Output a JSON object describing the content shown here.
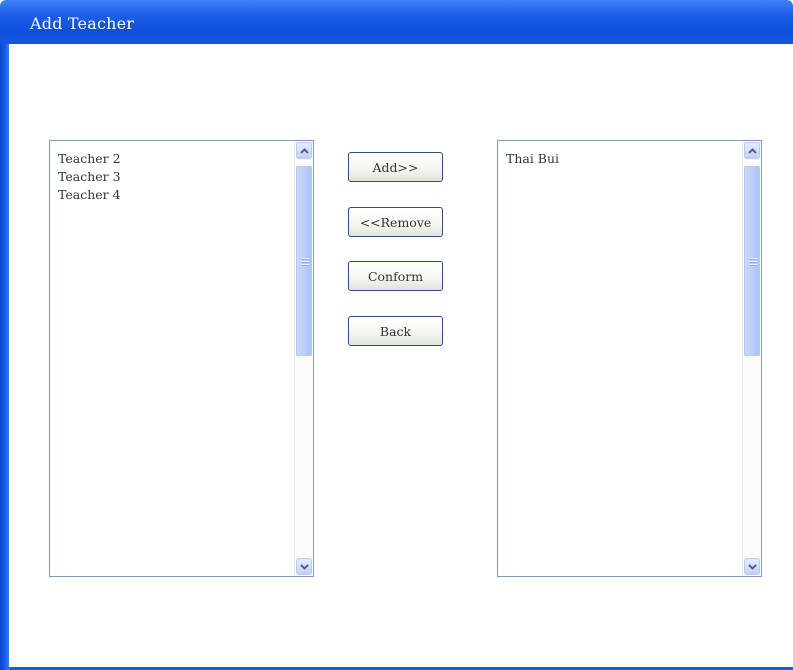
{
  "window": {
    "title": "Add Teacher"
  },
  "available_list": {
    "items": [
      "Teacher 2",
      "Teacher 3",
      "Teacher 4"
    ]
  },
  "selected_list": {
    "items": [
      "Thai Bui"
    ]
  },
  "buttons": {
    "add": "Add>>",
    "remove": "<<Remove",
    "conform": "Conform",
    "back": "Back"
  },
  "colors": {
    "titlebar": "#1c5ee8",
    "title_text": "#ffffff",
    "button_border": "#2f4f7a",
    "list_border": "#7f9db9"
  }
}
